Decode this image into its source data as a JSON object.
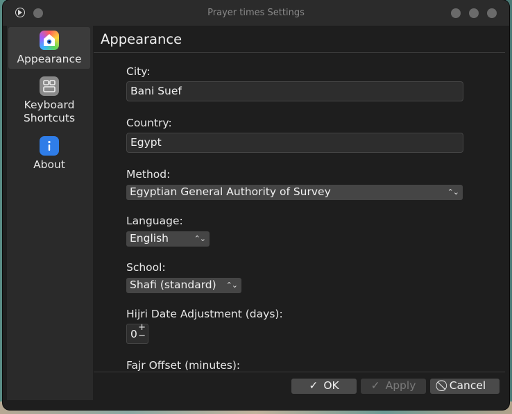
{
  "window": {
    "title": "Prayer times Settings"
  },
  "sidebar": {
    "items": [
      {
        "label": "Appearance",
        "icon": "appearance-icon"
      },
      {
        "label": "Keyboard\nShortcuts",
        "icon": "keyboard-shortcuts-icon"
      },
      {
        "label": "About",
        "icon": "info-icon"
      }
    ]
  },
  "page": {
    "title": "Appearance"
  },
  "form": {
    "city": {
      "label": "City:",
      "value": "Bani Suef"
    },
    "country": {
      "label": "Country:",
      "value": "Egypt"
    },
    "method": {
      "label": "Method:",
      "value": "Egyptian General Authority of Survey"
    },
    "language": {
      "label": "Language:",
      "value": "English"
    },
    "school": {
      "label": "School:",
      "value": "Shafi (standard)"
    },
    "hijri": {
      "label": "Hijri Date Adjustment (days):",
      "value": "0"
    },
    "fajr": {
      "label": "Fajr Offset (minutes):"
    }
  },
  "buttons": {
    "ok": "OK",
    "apply": "Apply",
    "cancel": "Cancel"
  },
  "colors": {
    "window_bg": "#1e1e1e",
    "sidebar_bg": "#2a2a2a",
    "button_bg": "#4a4a4a"
  }
}
